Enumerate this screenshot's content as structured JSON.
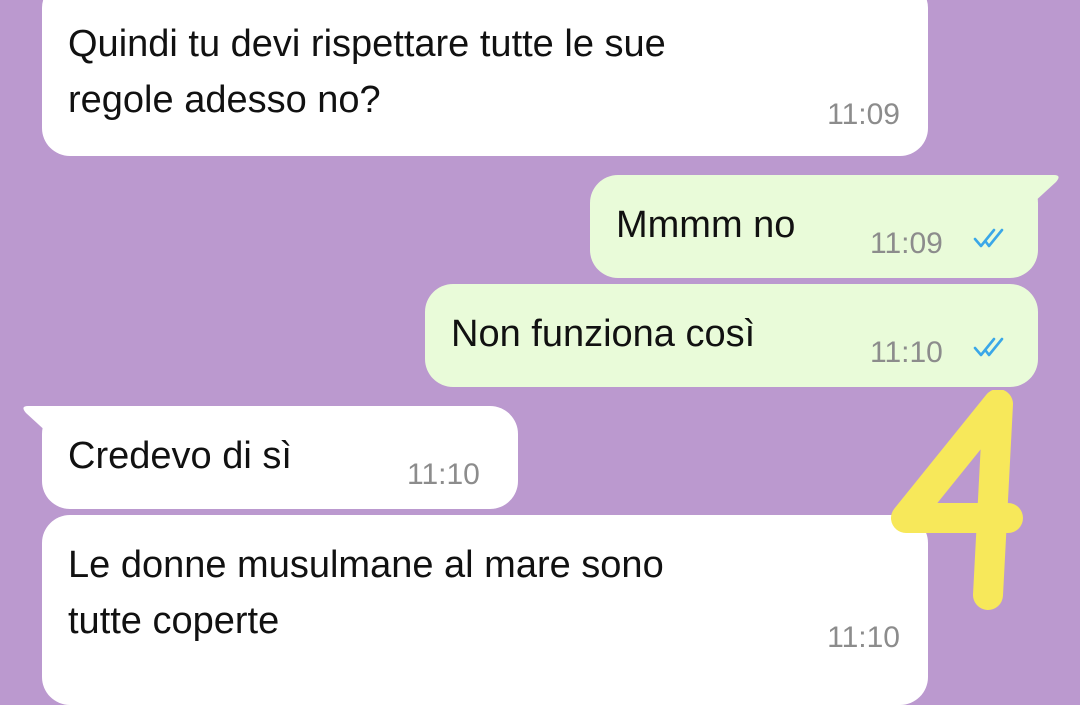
{
  "messages": [
    {
      "direction": "incoming",
      "lines": "Quindi tu devi rispettare tutte le sue\nregole adesso no?",
      "time": "11:09"
    },
    {
      "direction": "outgoing",
      "lines": "Mmmm no",
      "time": "11:09",
      "status_icon": "double-check-read-icon"
    },
    {
      "direction": "outgoing",
      "lines": "Non funziona così",
      "time": "11:10",
      "status_icon": "double-check-read-icon"
    },
    {
      "direction": "incoming",
      "lines": "Credevo di sì",
      "time": "11:10"
    },
    {
      "direction": "incoming",
      "lines": "Le donne musulmane al mare sono\ntutte coperte",
      "time": "11:10"
    }
  ],
  "annotation": {
    "text": "4",
    "color": "#f7e85a"
  },
  "colors": {
    "background": "#bb99cf",
    "incoming_bubble": "#ffffff",
    "outgoing_bubble": "#e9fbd9",
    "read_ticks": "#3aa7e8",
    "timestamp": "#8c8c8c"
  }
}
